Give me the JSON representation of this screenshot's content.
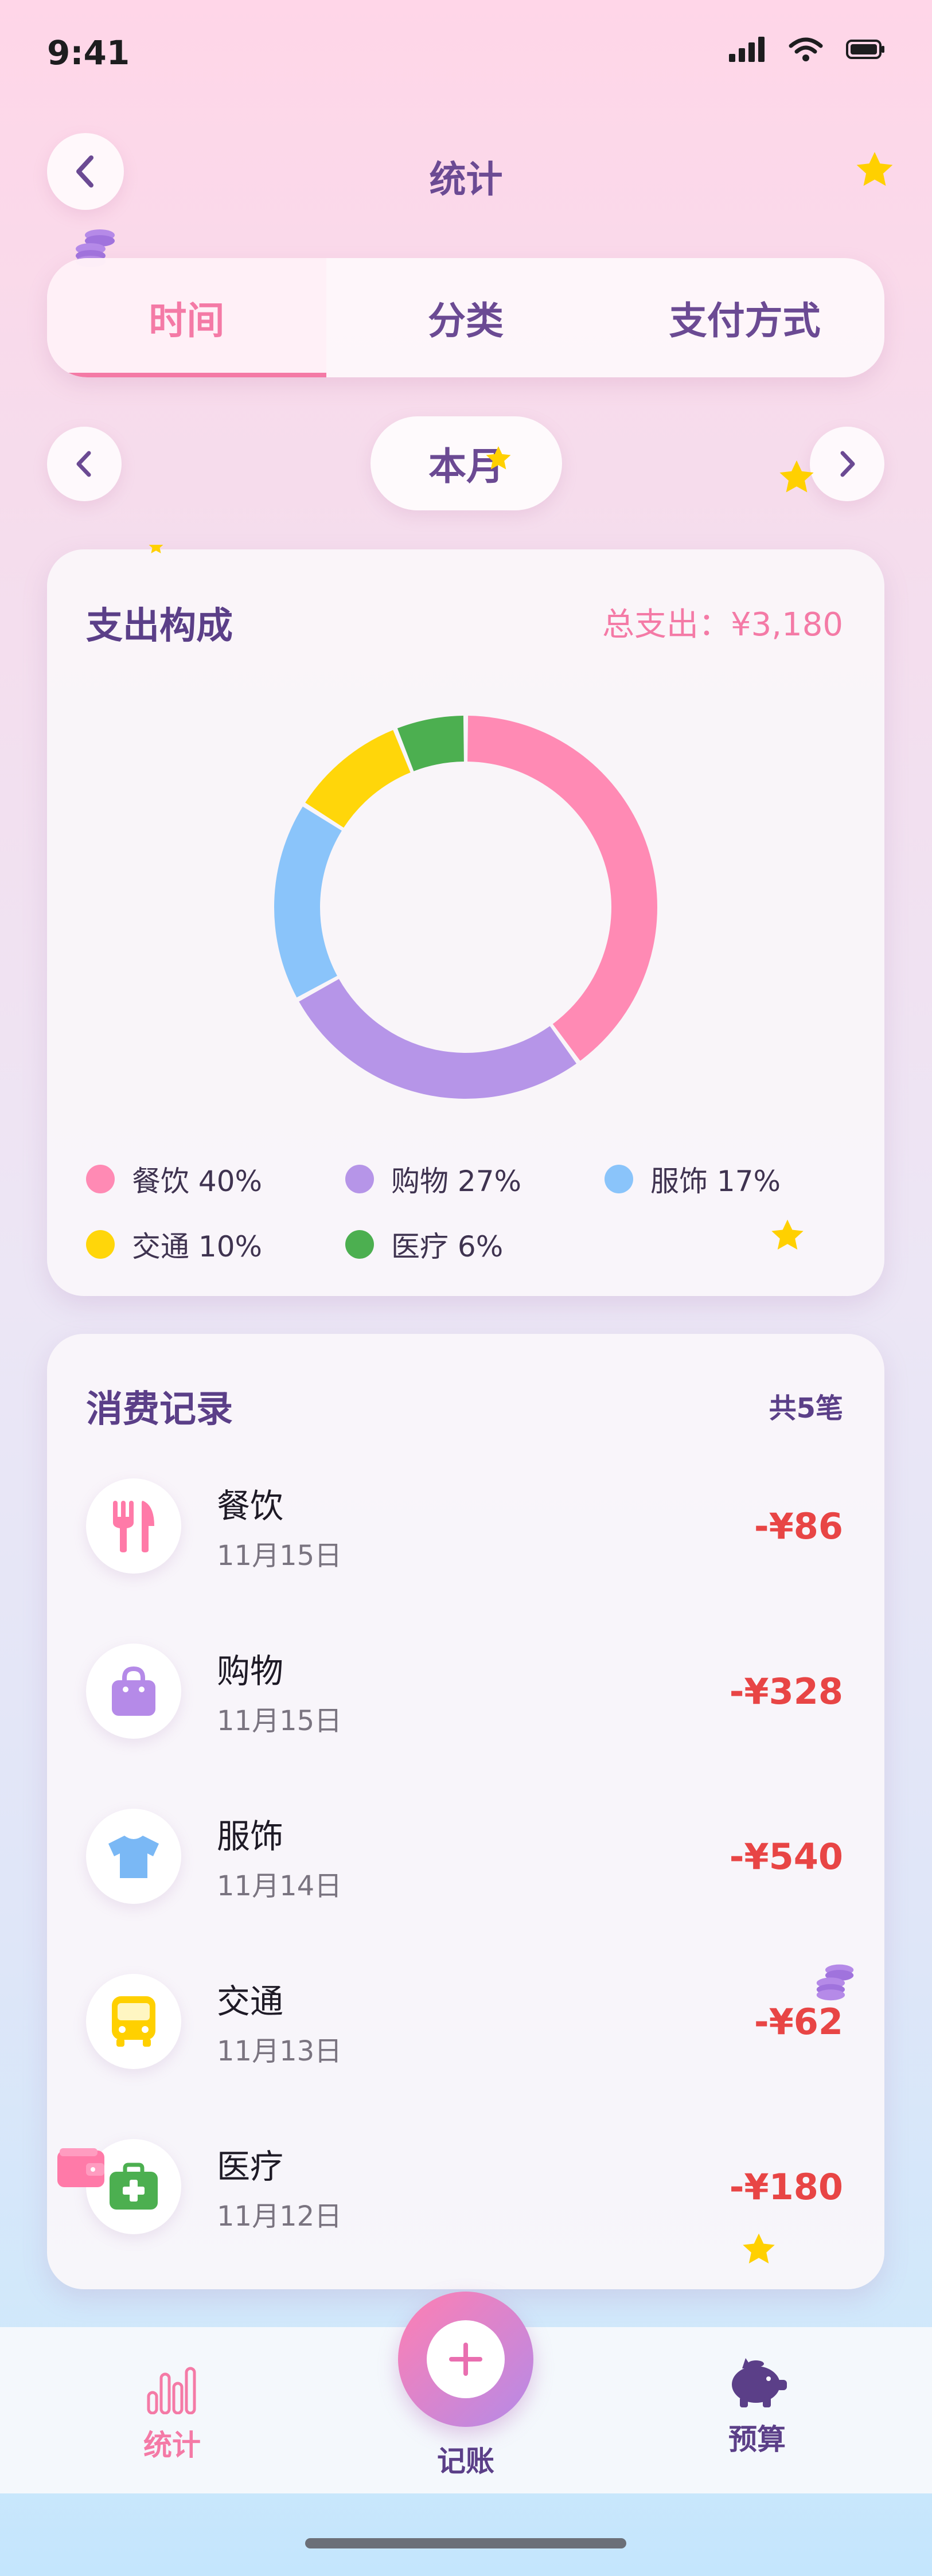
{
  "status_bar": {
    "time": "9:41"
  },
  "header": {
    "title": "统计"
  },
  "tabs": [
    {
      "label": "时间",
      "active": true
    },
    {
      "label": "分类",
      "active": false
    },
    {
      "label": "支付方式",
      "active": false
    }
  ],
  "period": {
    "label": "本月"
  },
  "composition": {
    "title": "支出构成",
    "total_label": "总支出：¥3,180"
  },
  "chart_data": {
    "type": "pie",
    "variant": "donut",
    "categories": [
      "餐饮",
      "购物",
      "服饰",
      "交通",
      "医疗"
    ],
    "values": [
      40,
      27,
      17,
      10,
      6
    ],
    "unit": "%",
    "colors": [
      "#ff8ab4",
      "#b695e8",
      "#8ac4fa",
      "#ffd60a",
      "#4caf50"
    ],
    "legend_labels": [
      "餐饮 40%",
      "购物 27%",
      "服饰 17%",
      "交通 10%",
      "医疗 6%"
    ],
    "legend_position": "bottom"
  },
  "records": {
    "title": "消费记录",
    "count_label": "共5笔",
    "items": [
      {
        "name": "餐饮",
        "date": "11月15日",
        "amount": "-¥86",
        "icon": "utensils-icon",
        "color": "#ff7aa8"
      },
      {
        "name": "购物",
        "date": "11月15日",
        "amount": "-¥328",
        "icon": "shopping-bag-icon",
        "color": "#b58ae8"
      },
      {
        "name": "服饰",
        "date": "11月14日",
        "amount": "-¥540",
        "icon": "tshirt-icon",
        "color": "#7ab8f5"
      },
      {
        "name": "交通",
        "date": "11月13日",
        "amount": "-¥62",
        "icon": "bus-icon",
        "color": "#ffd000"
      },
      {
        "name": "医疗",
        "date": "11月12日",
        "amount": "-¥180",
        "icon": "medical-kit-icon",
        "color": "#4caf50"
      }
    ]
  },
  "bottom_nav": {
    "stats_label": "统计",
    "add_label": "记账",
    "budget_label": "预算"
  },
  "colors": {
    "accent_pink": "#f47aa6",
    "title_purple": "#5b3f88",
    "expense_red": "#e84545"
  }
}
